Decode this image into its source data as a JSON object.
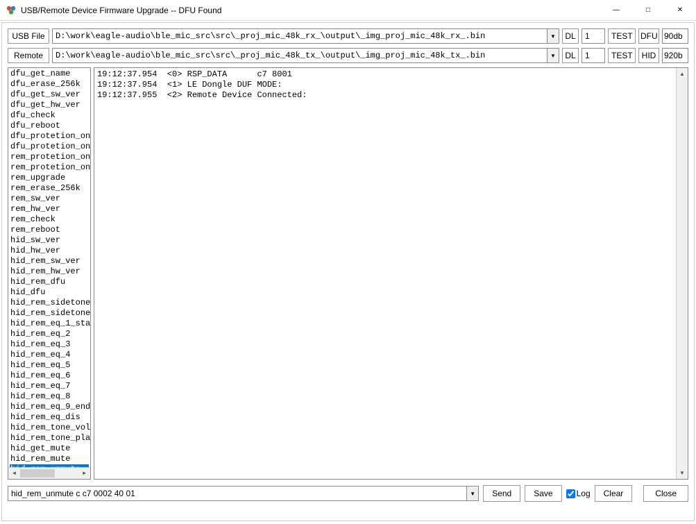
{
  "window": {
    "title": "USB/Remote Device Firmware Upgrade -- DFU Found"
  },
  "row1": {
    "file_label": "USB File",
    "path": "D:\\work\\eagle-audio\\ble_mic_src\\src\\_proj_mic_48k_rx_\\output\\_img_proj_mic_48k_rx_.bin",
    "dl_label": "DL",
    "num": "1",
    "test_label": "TEST",
    "tag_label": "DFU",
    "val": "90db"
  },
  "row2": {
    "remote_label": "Remote",
    "path": "D:\\work\\eagle-audio\\ble_mic_src\\src\\_proj_mic_48k_tx_\\output\\_img_proj_mic_48k_tx_.bin",
    "dl_label": "DL",
    "num": "1",
    "test_label": "TEST",
    "tag_label": "HID",
    "val": "920b"
  },
  "commands": [
    "dfu_get_name",
    "dfu_erase_256k",
    "dfu_get_sw_ver",
    "dfu_get_hw_ver",
    "dfu_check",
    "dfu_reboot",
    "dfu_protetion_on",
    "dfu_protetion_on",
    "rem_protetion_on",
    "rem_protetion_on",
    "rem_upgrade",
    "rem_erase_256k",
    "rem_sw_ver",
    "rem_hw_ver",
    "rem_check",
    "rem_reboot",
    "hid_sw_ver",
    "hid_hw_ver",
    "hid_rem_sw_ver",
    "hid_rem_hw_ver",
    "hid_rem_dfu",
    "hid_dfu",
    "hid_rem_sidetone",
    "hid_rem_sidetone",
    "hid_rem_eq_1_sta",
    "hid_rem_eq_2",
    "hid_rem_eq_3",
    "hid_rem_eq_4",
    "hid_rem_eq_5",
    "hid_rem_eq_6",
    "hid_rem_eq_7",
    "hid_rem_eq_8",
    "hid_rem_eq_9_end",
    "hid_rem_eq_dis",
    "hid_rem_tone_vol",
    "hid_rem_tone_pla",
    "hid_get_mute",
    "hid_rem_mute",
    "hid_rem_unmute"
  ],
  "selected_command_index": 38,
  "log_lines": [
    "19:12:37.954  <0> RSP_DATA      c7 8001",
    "19:12:37.954  <1> LE Dongle DUF MODE:",
    "19:12:37.955  <2> Remote Device Connected:"
  ],
  "bottom": {
    "cmd": "hid_rem_unmute c c7 0002 40 01",
    "send_label": "Send",
    "save_label": "Save",
    "log_label": "Log",
    "log_checked": true,
    "clear_label": "Clear",
    "close_label": "Close"
  }
}
